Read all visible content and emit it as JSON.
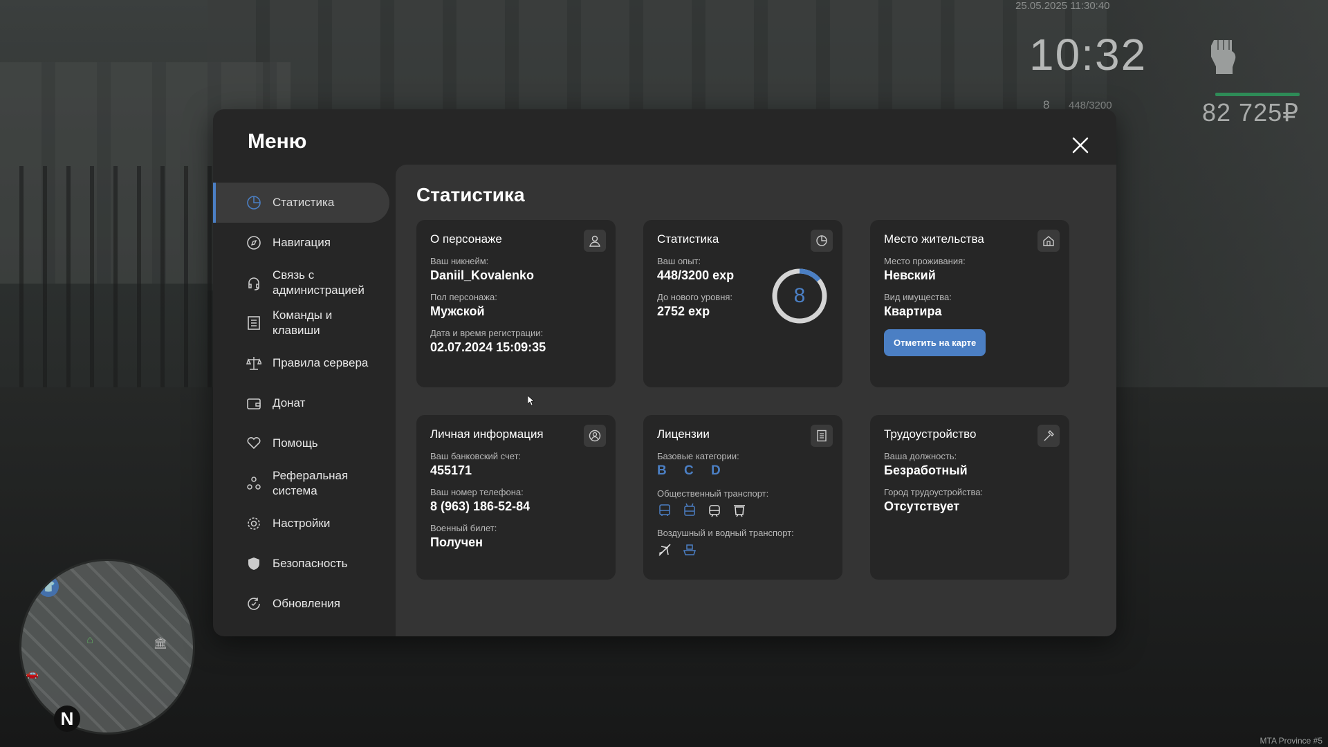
{
  "hud": {
    "datetime": "25.05.2025 11:30:40",
    "time": "10:32",
    "level": "8",
    "exp": "448/3200",
    "money": "82 725₽",
    "watermark": "MTA Province #5"
  },
  "minimap": {
    "compass": "N"
  },
  "menu": {
    "title": "Меню",
    "sidebar": [
      {
        "label": "Статистика",
        "icon": "pie-chart-icon",
        "active": true
      },
      {
        "label": "Навигация",
        "icon": "compass-icon"
      },
      {
        "label": "Связь с\nадминистрацией",
        "icon": "headset-icon"
      },
      {
        "label": "Команды и\nклавиши",
        "icon": "list-icon"
      },
      {
        "label": "Правила сервера",
        "icon": "scales-icon"
      },
      {
        "label": "Донат",
        "icon": "wallet-icon"
      },
      {
        "label": "Помощь",
        "icon": "heart-hand-icon"
      },
      {
        "label": "Реферальная\nсистема",
        "icon": "people-icon"
      },
      {
        "label": "Настройки",
        "icon": "gear-icon"
      },
      {
        "label": "Безопасность",
        "icon": "shield-icon"
      },
      {
        "label": "Обновления",
        "icon": "refresh-icon"
      }
    ]
  },
  "stats": {
    "title": "Статистика",
    "character": {
      "title": "О персонаже",
      "nick_label": "Ваш никнейм:",
      "nick": "Daniil_Kovalenko",
      "gender_label": "Пол персонажа:",
      "gender": "Мужской",
      "reg_label": "Дата и время регистрации:",
      "reg": "02.07.2024 15:09:35"
    },
    "statistics": {
      "title": "Статистика",
      "exp_label": "Ваш опыт:",
      "exp": "448/3200 exp",
      "next_label": "До нового уровня:",
      "next": "2752 exp",
      "level": "8",
      "progress": 0.14
    },
    "residence": {
      "title": "Место жительства",
      "place_label": "Место проживания:",
      "place": "Невский",
      "type_label": "Вид имущества:",
      "type": "Квартира",
      "button": "Отметить на карте"
    },
    "personal": {
      "title": "Личная информация",
      "bank_label": "Ваш банковский счет:",
      "bank": "455171",
      "phone_label": "Ваш номер телефона:",
      "phone": "8 (963) 186-52-84",
      "military_label": "Военный билет:",
      "military": "Получен"
    },
    "licenses": {
      "title": "Лицензии",
      "base_label": "Базовые категории:",
      "base": "B C D",
      "public_label": "Общественный транспорт:",
      "air_label": "Воздушный и водный транспорт:"
    },
    "employment": {
      "title": "Трудоустройство",
      "position_label": "Ваша должность:",
      "position": "Безработный",
      "city_label": "Город трудоустройства:",
      "city": "Отсутствует"
    }
  },
  "colors": {
    "accent": "#4b7fc4",
    "panel": "#262626",
    "content": "#343434"
  }
}
